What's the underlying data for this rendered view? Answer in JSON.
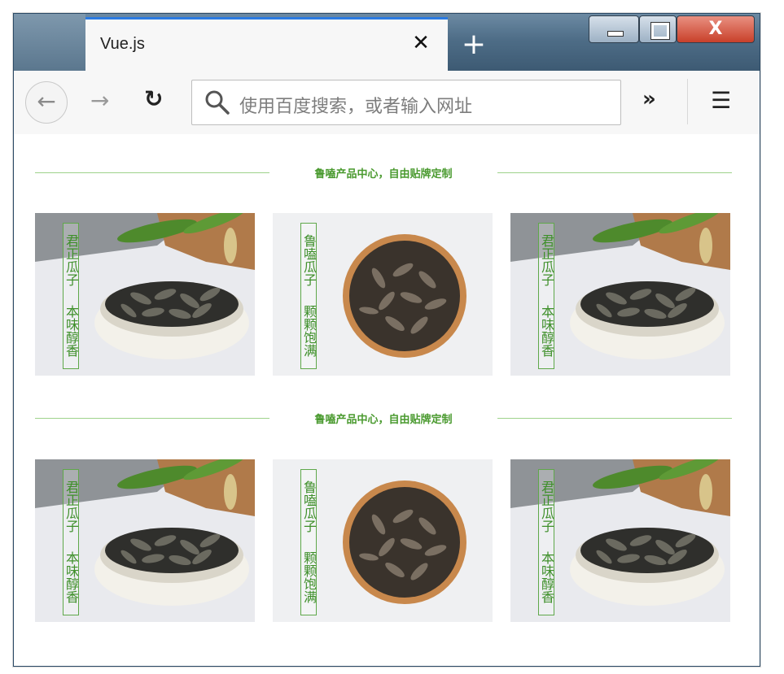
{
  "browser": {
    "tab_title": "Vue.js",
    "tab_close_glyph": "✕",
    "new_tab_glyph": "+",
    "url_placeholder": "使用百度搜索，或者输入网址",
    "overflow_glyph": "»",
    "menu_glyph": "☰",
    "close_glyph": "X",
    "accent_color": "#2a7ae2"
  },
  "page": {
    "sections": [
      {
        "header": "鲁嗑产品中心，自由贴牌定制",
        "products": [
          {
            "label_top": "君正瓜子",
            "label_bottom": "本味醇香",
            "style": "bowl"
          },
          {
            "label_top": "鲁嗑瓜子",
            "label_bottom": "颗颗饱满",
            "style": "plate"
          },
          {
            "label_top": "君正瓜子",
            "label_bottom": "本味醇香",
            "style": "bowl"
          }
        ]
      },
      {
        "header": "鲁嗑产品中心，自由贴牌定制",
        "products": [
          {
            "label_top": "君正瓜子",
            "label_bottom": "本味醇香",
            "style": "bowl"
          },
          {
            "label_top": "鲁嗑瓜子",
            "label_bottom": "颗颗饱满",
            "style": "plate"
          },
          {
            "label_top": "君正瓜子",
            "label_bottom": "本味醇香",
            "style": "bowl"
          }
        ]
      }
    ],
    "label_color": "#3e8f2a",
    "line_color": "#9ed28b"
  }
}
